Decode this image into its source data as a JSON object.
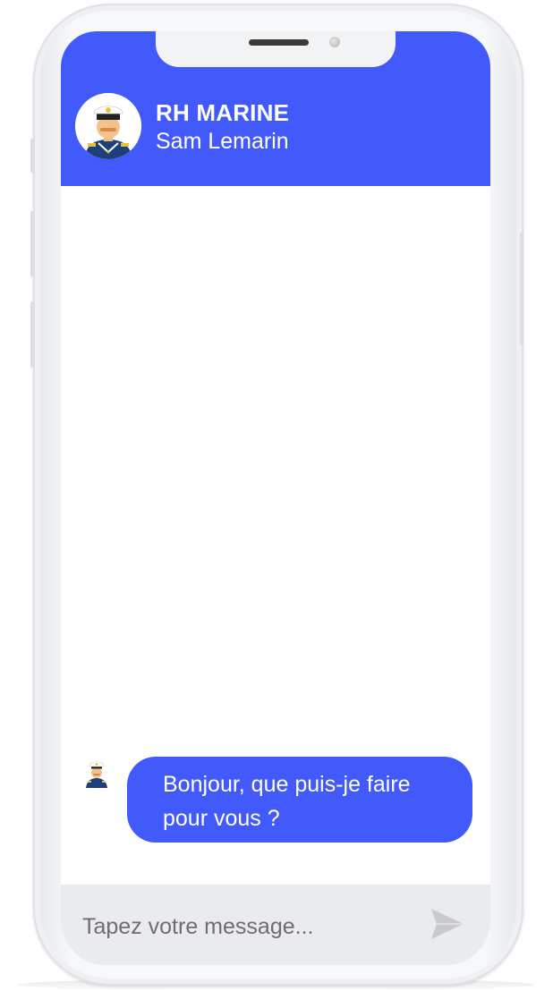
{
  "header": {
    "title": "RH MARINE",
    "subtitle": "Sam Lemarin",
    "avatar_icon": "sailor-captain-avatar-icon"
  },
  "messages": [
    {
      "sender": "bot",
      "avatar_icon": "sailor-captain-avatar-icon",
      "text": "Bonjour, que puis-je faire pour vous ?"
    }
  ],
  "composer": {
    "placeholder": "Tapez votre message...",
    "value": "",
    "send_icon": "send-icon"
  },
  "colors": {
    "accent": "#4259fc",
    "composer_bg": "#eaebee",
    "bubble_text": "#ffffff"
  }
}
